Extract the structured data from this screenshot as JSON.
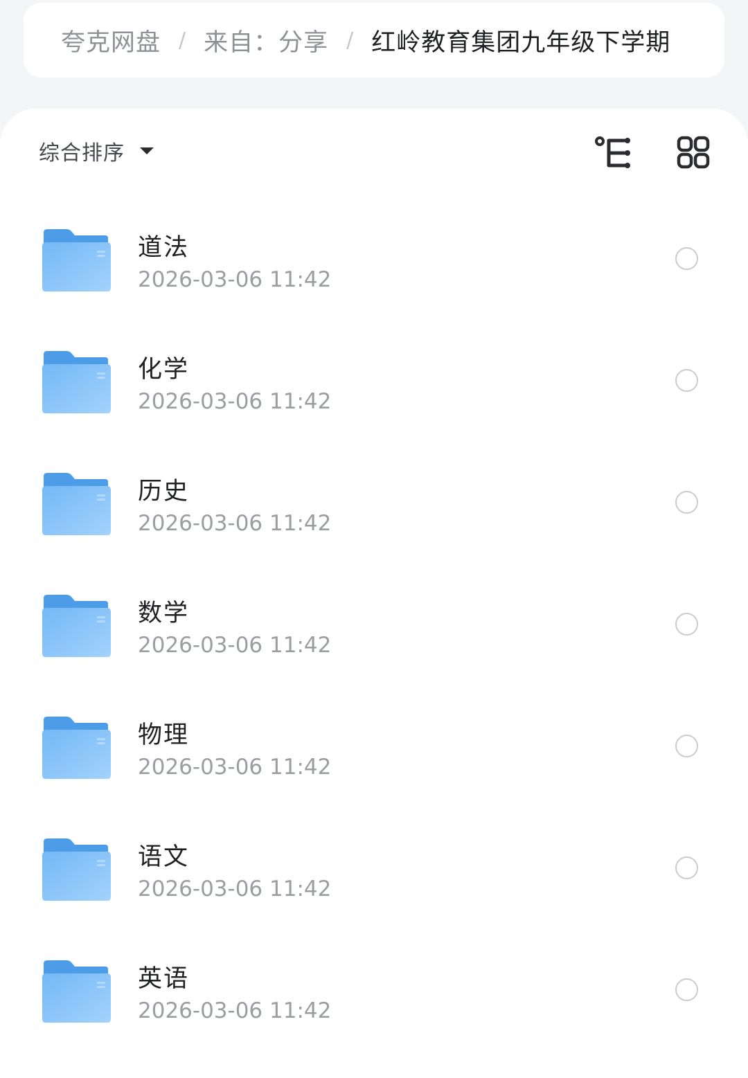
{
  "breadcrumb": {
    "root": "夸克网盘",
    "middle": "来自：分享",
    "current": "红岭教育集团九年级下学期",
    "separator": "/"
  },
  "toolbar": {
    "sort_label": "综合排序",
    "sort_icon": "caret-down-icon",
    "tree_icon": "tree-view-icon",
    "grid_icon": "grid-view-icon"
  },
  "files": [
    {
      "name": "道法",
      "time": "2026-03-06 11:42"
    },
    {
      "name": "化学",
      "time": "2026-03-06 11:42"
    },
    {
      "name": "历史",
      "time": "2026-03-06 11:42"
    },
    {
      "name": "数学",
      "time": "2026-03-06 11:42"
    },
    {
      "name": "物理",
      "time": "2026-03-06 11:42"
    },
    {
      "name": "语文",
      "time": "2026-03-06 11:42"
    },
    {
      "name": "英语",
      "time": "2026-03-06 11:42"
    }
  ],
  "colors": {
    "folder_back": "#5aa6ef",
    "folder_front": "#8cc7fb",
    "text_primary": "#1f2023",
    "text_secondary": "#9a9da2",
    "background": "#f4f5f7"
  }
}
